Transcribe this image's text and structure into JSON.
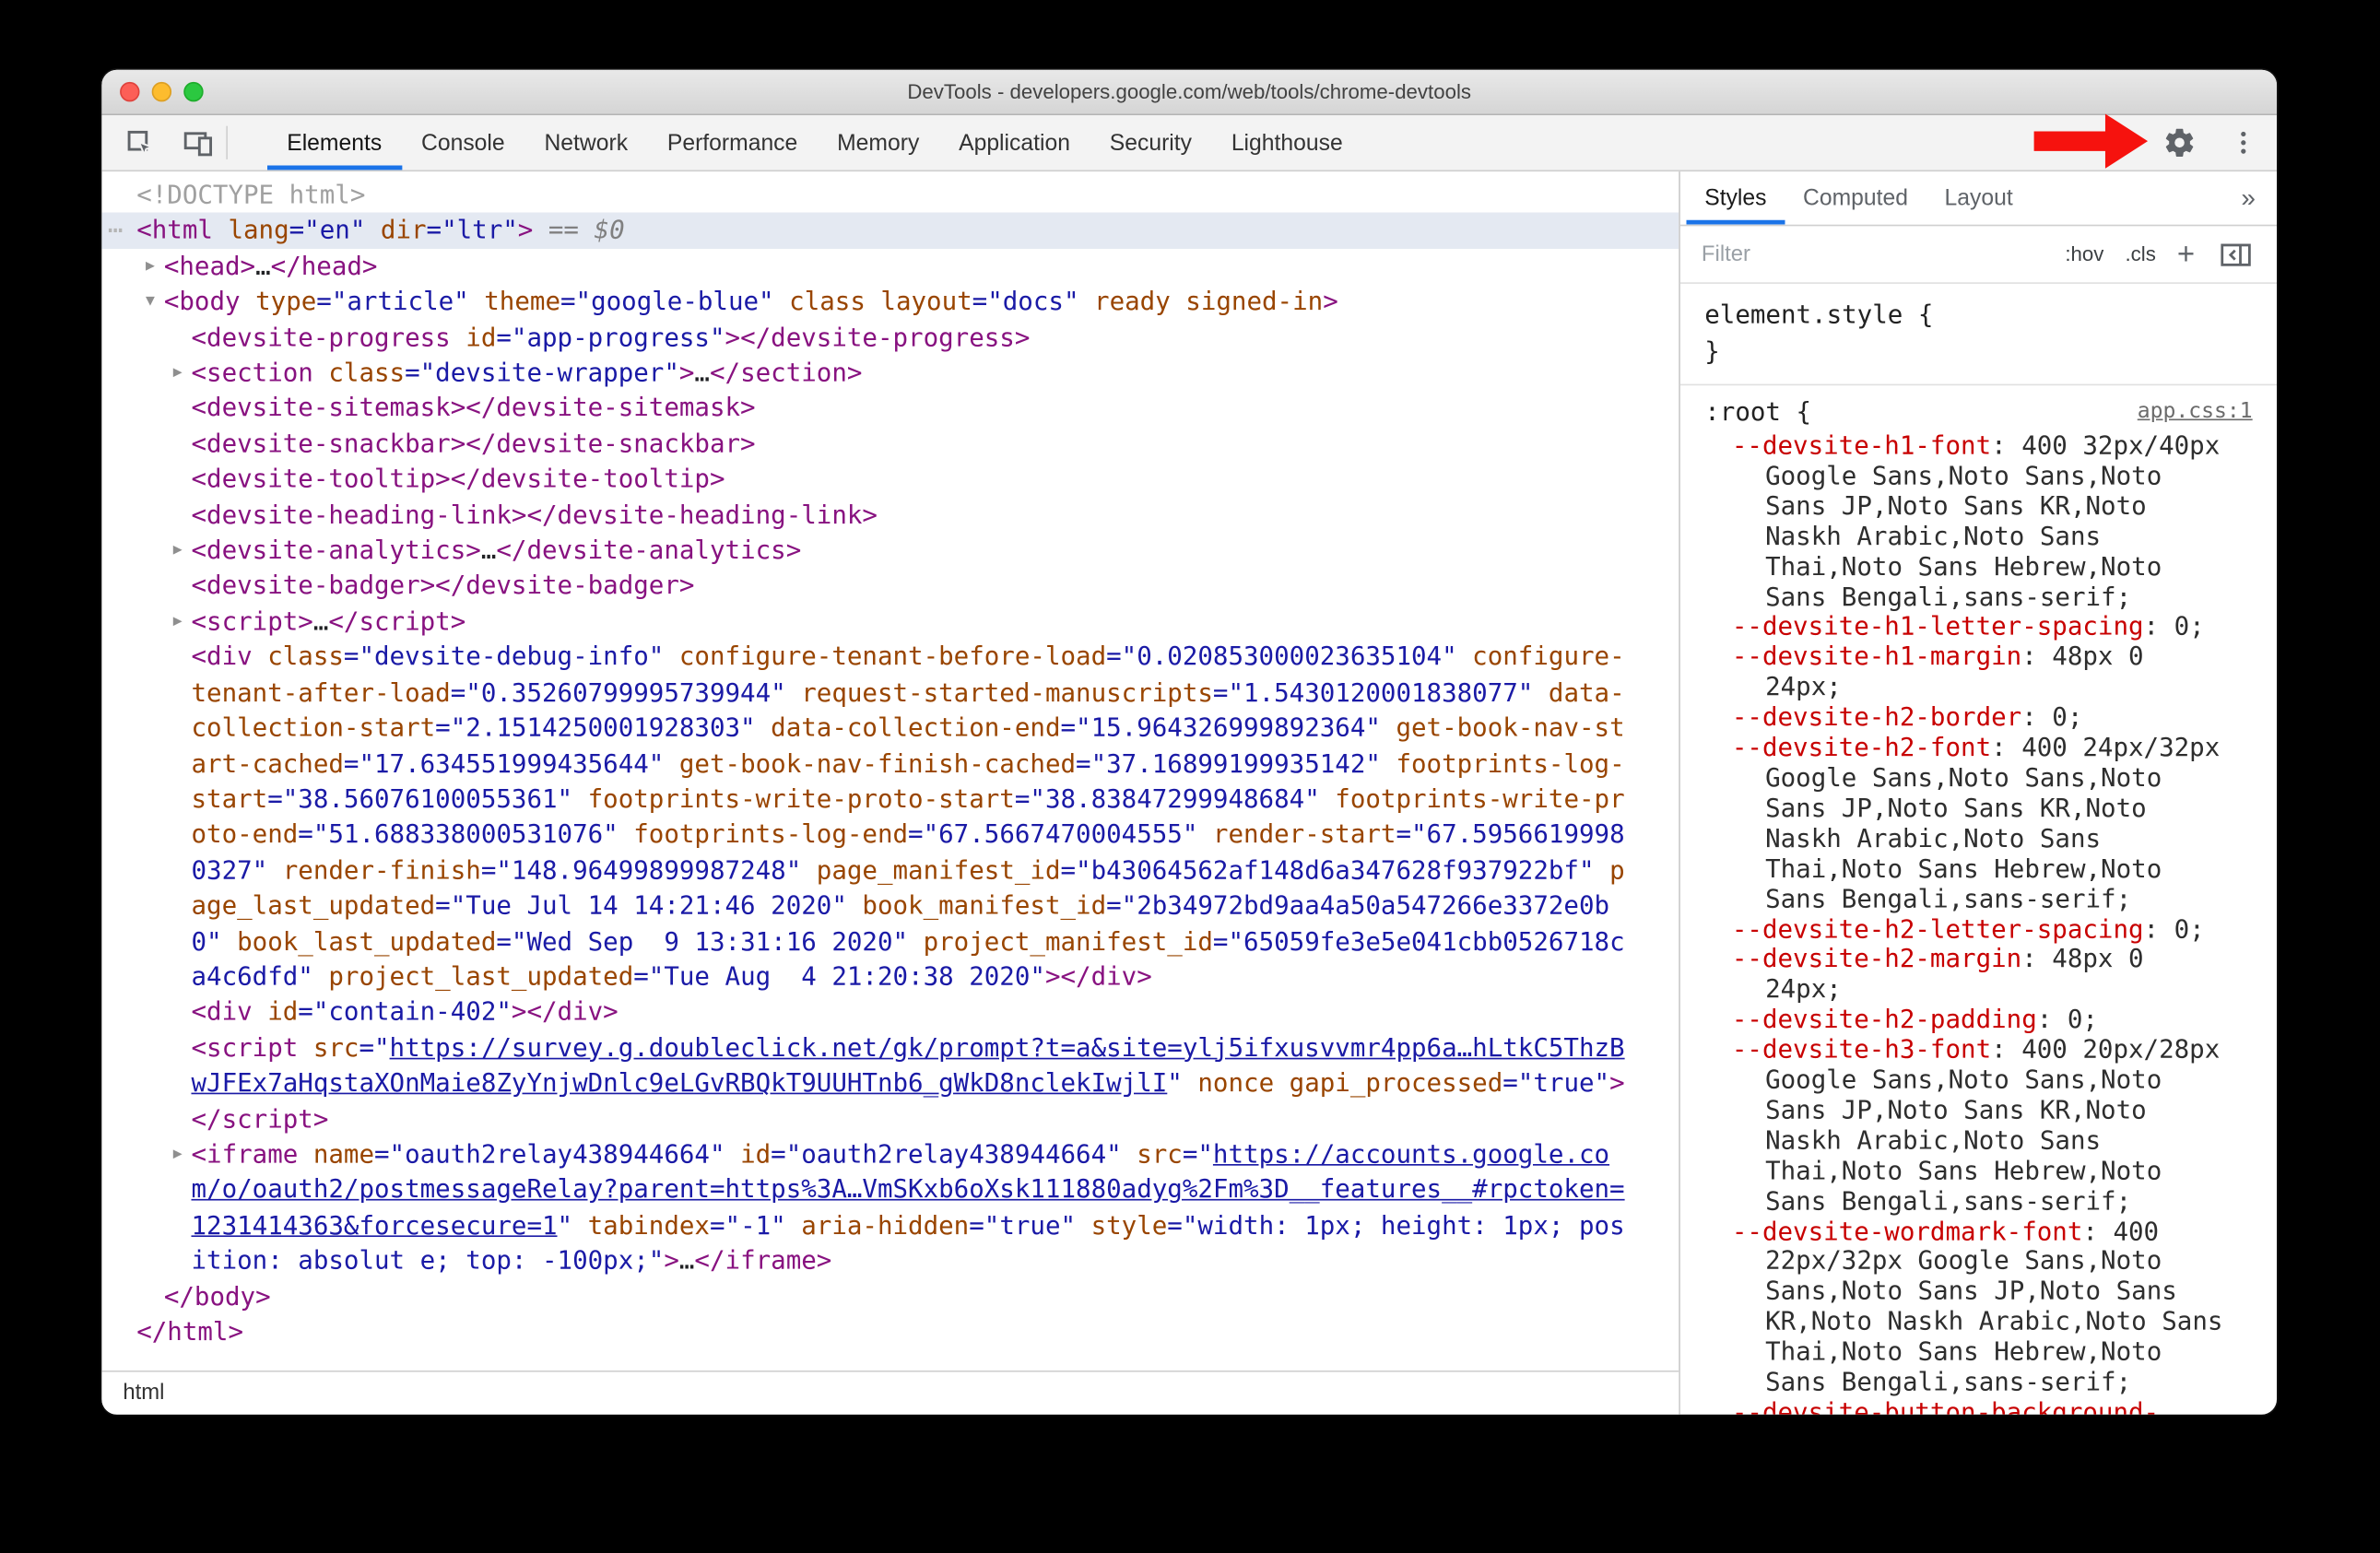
{
  "window": {
    "title": "DevTools - developers.google.com/web/tools/chrome-devtools"
  },
  "toolbar": {
    "tabs": [
      "Elements",
      "Console",
      "Network",
      "Performance",
      "Memory",
      "Application",
      "Security",
      "Lighthouse"
    ],
    "selected_tab": "Elements",
    "annotation": {
      "shape": "red-arrow-pointing-right",
      "color": "#f6120e",
      "target": "settings-gear-button"
    }
  },
  "elements_panel": {
    "breadcrumbs": [
      "html"
    ],
    "tree": [
      {
        "i": 0,
        "s": [
          [
            "d",
            "<!DOCTYPE html>"
          ]
        ]
      },
      {
        "i": 0,
        "sel": true,
        "dots": true,
        "s": [
          [
            "t",
            "<html "
          ],
          [
            "a",
            "lang"
          ],
          [
            "v",
            "=\"en\" "
          ],
          [
            "a",
            "dir"
          ],
          [
            "v",
            "=\"ltr\""
          ],
          [
            "t",
            ">"
          ],
          [
            "g",
            " == "
          ],
          [
            "i",
            "$0"
          ]
        ]
      },
      {
        "i": 1,
        "ar": "r",
        "s": [
          [
            "t",
            "<head>"
          ],
          [
            "p",
            "…"
          ],
          [
            "t",
            "</head>"
          ]
        ]
      },
      {
        "i": 1,
        "ar": "d",
        "s": [
          [
            "t",
            "<body "
          ],
          [
            "a",
            "type"
          ],
          [
            "v",
            "=\"article\" "
          ],
          [
            "a",
            "theme"
          ],
          [
            "v",
            "=\"google-blue\" "
          ],
          [
            "a",
            "class "
          ],
          [
            "a",
            "layout"
          ],
          [
            "v",
            "=\"docs\" "
          ],
          [
            "a",
            "ready "
          ],
          [
            "a",
            "signed-in"
          ],
          [
            "t",
            ">"
          ]
        ]
      },
      {
        "i": 2,
        "s": [
          [
            "t",
            "<devsite-progress "
          ],
          [
            "a",
            "id"
          ],
          [
            "v",
            "=\"app-progress\""
          ],
          [
            "t",
            "></devsite-progress>"
          ]
        ]
      },
      {
        "i": 2,
        "ar": "r",
        "s": [
          [
            "t",
            "<section "
          ],
          [
            "a",
            "class"
          ],
          [
            "v",
            "=\"devsite-wrapper\""
          ],
          [
            "t",
            ">"
          ],
          [
            "p",
            "…"
          ],
          [
            "t",
            "</section>"
          ]
        ]
      },
      {
        "i": 2,
        "s": [
          [
            "t",
            "<devsite-sitemask></devsite-sitemask>"
          ]
        ]
      },
      {
        "i": 2,
        "s": [
          [
            "t",
            "<devsite-snackbar></devsite-snackbar>"
          ]
        ]
      },
      {
        "i": 2,
        "s": [
          [
            "t",
            "<devsite-tooltip></devsite-tooltip>"
          ]
        ]
      },
      {
        "i": 2,
        "s": [
          [
            "t",
            "<devsite-heading-link></devsite-heading-link>"
          ]
        ]
      },
      {
        "i": 2,
        "ar": "r",
        "s": [
          [
            "t",
            "<devsite-analytics>"
          ],
          [
            "p",
            "…"
          ],
          [
            "t",
            "</devsite-analytics>"
          ]
        ]
      },
      {
        "i": 2,
        "s": [
          [
            "t",
            "<devsite-badger></devsite-badger>"
          ]
        ]
      },
      {
        "i": 2,
        "ar": "r",
        "s": [
          [
            "t",
            "<script>"
          ],
          [
            "p",
            "…"
          ],
          [
            "t",
            "</script>"
          ]
        ]
      },
      {
        "i": 2,
        "s": [
          [
            "t",
            "<div "
          ],
          [
            "a",
            "class"
          ],
          [
            "v",
            "=\"devsite-debug-info\" "
          ],
          [
            "a",
            "configure-tenant-before-load"
          ],
          [
            "v",
            "=\"0.020853000023635104\" "
          ],
          [
            "a",
            "configure-tenant-after-load"
          ],
          [
            "v",
            "=\"0.35260799995739944\" "
          ],
          [
            "a",
            "request-started-manuscripts"
          ],
          [
            "v",
            "=\"1.5430120001838077\" "
          ],
          [
            "a",
            "data-collection-start"
          ],
          [
            "v",
            "=\"2.1514250001928303\" "
          ],
          [
            "a",
            "data-collection-end"
          ],
          [
            "v",
            "=\"15.964326999892364\" "
          ],
          [
            "a",
            "get-book-nav-start-cached"
          ],
          [
            "v",
            "=\"17.634551999435644\" "
          ],
          [
            "a",
            "get-book-nav-finish-cached"
          ],
          [
            "v",
            "=\"37.16899199935142\" "
          ],
          [
            "a",
            "footprints-log-start"
          ],
          [
            "v",
            "=\"38.56076100055361\" "
          ],
          [
            "a",
            "footprints-write-proto-start"
          ],
          [
            "v",
            "=\"38.83847299948684\" "
          ],
          [
            "a",
            "footprints-write-proto-end"
          ],
          [
            "v",
            "=\"51.688338000531076\" "
          ],
          [
            "a",
            "footprints-log-end"
          ],
          [
            "v",
            "=\"67.5667470004555\" "
          ],
          [
            "a",
            "render-start"
          ],
          [
            "v",
            "=\"67.59566199980327\" "
          ],
          [
            "a",
            "render-finish"
          ],
          [
            "v",
            "=\"148.96499899987248\" "
          ],
          [
            "a",
            "page_manifest_id"
          ],
          [
            "v",
            "=\"b43064562af148d6a347628f937922bf\" "
          ],
          [
            "a",
            "page_last_updated"
          ],
          [
            "v",
            "=\"Tue Jul 14 14:21:46 2020\" "
          ],
          [
            "a",
            "book_manifest_id"
          ],
          [
            "v",
            "=\"2b34972bd9aa4a50a547266e3372e0b0\" "
          ],
          [
            "a",
            "book_last_updated"
          ],
          [
            "v",
            "=\"Wed Sep  9 13:31:16 2020\" "
          ],
          [
            "a",
            "project_manifest_id"
          ],
          [
            "v",
            "=\"65059fe3e5e041cbb0526718ca4c6dfd\" "
          ],
          [
            "a",
            "project_last_updated"
          ],
          [
            "v",
            "=\"Tue Aug  4 21:20:38 2020\""
          ],
          [
            "t",
            "></div>"
          ]
        ]
      },
      {
        "i": 2,
        "s": [
          [
            "t",
            "<div "
          ],
          [
            "a",
            "id"
          ],
          [
            "v",
            "=\"contain-402\""
          ],
          [
            "t",
            "></div>"
          ]
        ]
      },
      {
        "i": 2,
        "s": [
          [
            "t",
            "<script "
          ],
          [
            "a",
            "src"
          ],
          [
            "v",
            "=\""
          ],
          [
            "l",
            "https://survey.g.doubleclick.net/gk/prompt?t=a&site=ylj5ifxusvvmr4pp6a…hLtkC5ThzBwJFEx7aHqstaXOnMaie8ZyYnjwDnlc9eLGvRBQkT9UUHTnb6_gWkD8nclekIwjlI"
          ],
          [
            "v",
            "\" "
          ],
          [
            "a",
            "nonce "
          ],
          [
            "a",
            "gapi_processed"
          ],
          [
            "v",
            "=\"true\""
          ],
          [
            "t",
            ">"
          ]
        ]
      },
      {
        "i": 2,
        "s": [
          [
            "t",
            "</script>"
          ]
        ]
      },
      {
        "i": 2,
        "ar": "r",
        "s": [
          [
            "t",
            "<iframe "
          ],
          [
            "a",
            "name"
          ],
          [
            "v",
            "=\"oauth2relay438944664\" "
          ],
          [
            "a",
            "id"
          ],
          [
            "v",
            "=\"oauth2relay438944664\" "
          ],
          [
            "a",
            "src"
          ],
          [
            "v",
            "=\""
          ],
          [
            "l",
            "https://accounts.google.com/o/oauth2/postmessageRelay?parent=https%3A…VmSKxb6oXsk111880adyg%2Fm%3D__features__#rpctoken=1231414363&forcesecure=1"
          ],
          [
            "v",
            "\" "
          ],
          [
            "a",
            "tabindex"
          ],
          [
            "v",
            "=\"-1\" "
          ],
          [
            "a",
            "aria-hidden"
          ],
          [
            "v",
            "=\"true\" "
          ],
          [
            "a",
            "style"
          ],
          [
            "v",
            "=\"width: 1px; height: 1px; position: absolut e; top: -100px;\""
          ],
          [
            "t",
            ">"
          ],
          [
            "p",
            "…"
          ],
          [
            "t",
            "</iframe>"
          ]
        ]
      },
      {
        "i": 1,
        "s": [
          [
            "t",
            "</body>"
          ]
        ]
      },
      {
        "i": 0,
        "s": [
          [
            "t",
            "</html>"
          ]
        ]
      }
    ]
  },
  "styles_panel": {
    "tabs": [
      "Styles",
      "Computed",
      "Layout"
    ],
    "selected_tab": "Styles",
    "overflow_button": "»",
    "filter": {
      "placeholder": "Filter"
    },
    "state_buttons": [
      ":hov",
      ".cls"
    ],
    "new_rule_button": "+",
    "element_style": {
      "selector": "element.style",
      "brace_open": "{",
      "brace_close": "}"
    },
    "rules": [
      {
        "selector": ":root",
        "brace_open": "{",
        "source": "app.css:1",
        "declarations": [
          {
            "name": "--devsite-h1-font",
            "value": "400 32px/40px Google Sans,Noto Sans,Noto Sans JP,Noto Sans KR,Noto Naskh Arabic,Noto Sans Thai,Noto Sans Hebrew,Noto Sans Bengali,sans-serif;"
          },
          {
            "name": "--devsite-h1-letter-spacing",
            "value": "0;"
          },
          {
            "name": "--devsite-h1-margin",
            "value": "48px 0 24px;"
          },
          {
            "name": "--devsite-h2-border",
            "value": "0;"
          },
          {
            "name": "--devsite-h2-font",
            "value": "400 24px/32px Google Sans,Noto Sans,Noto Sans JP,Noto Sans KR,Noto Naskh Arabic,Noto Sans Thai,Noto Sans Hebrew,Noto Sans Bengali,sans-serif;"
          },
          {
            "name": "--devsite-h2-letter-spacing",
            "value": "0;"
          },
          {
            "name": "--devsite-h2-margin",
            "value": "48px 0 24px;"
          },
          {
            "name": "--devsite-h2-padding",
            "value": "0;"
          },
          {
            "name": "--devsite-h3-font",
            "value": "400 20px/28px Google Sans,Noto Sans,Noto Sans JP,Noto Sans KR,Noto Naskh Arabic,Noto Sans Thai,Noto Sans Hebrew,Noto Sans Bengali,sans-serif;"
          },
          {
            "name": "--devsite-wordmark-font",
            "value": "400 22px/32px Google Sans,Noto Sans,Noto Sans JP,Noto Sans KR,Noto Naskh Arabic,Noto Sans Thai,Noto Sans Hebrew,Noto Sans Bengali,sans-serif;"
          },
          {
            "name": "--devsite-button-background-hover",
            "value": ""
          }
        ]
      }
    ]
  },
  "colors": {
    "accent_blue": "#1a73e8",
    "tag": "#881280",
    "attribute": "#994500",
    "value": "#1a1aa6",
    "property": "#c80000",
    "annotation_red": "#f6120e"
  }
}
